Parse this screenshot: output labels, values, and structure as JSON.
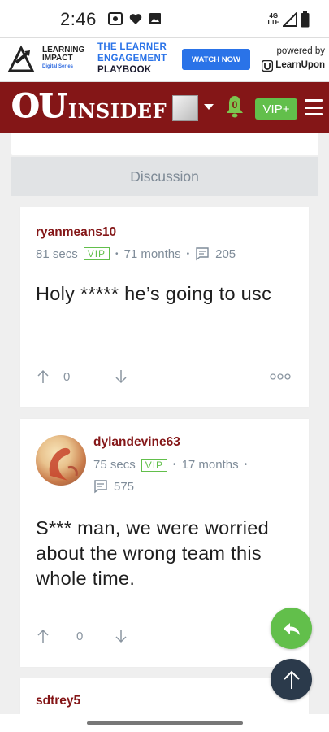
{
  "status_bar": {
    "time": "2:46",
    "network": "4G\nLTE",
    "icons": [
      "screen-record-icon",
      "heart-icon",
      "image-icon",
      "signal-icon",
      "battery-icon"
    ]
  },
  "ad": {
    "brand_line1": "LEARNING",
    "brand_line2": "IMPACT",
    "brand_sub": "Digital Series",
    "headline_1": "THE LEARNER",
    "headline_2": "ENGAGEMENT",
    "headline_3": "PLAYBOOK",
    "cta": "WATCH NOW",
    "powered_by": "powered by",
    "sponsor": "LearnUpon"
  },
  "header": {
    "brand_ou": "OU",
    "brand_insider": "INSIDEF",
    "notification_count": "0",
    "vip_label": "VIP+"
  },
  "section_title": "Discussion",
  "posts": [
    {
      "username": "ryanmeans10",
      "time": "81 secs",
      "badge": "VIP",
      "tenure": "71 months",
      "post_count": "205",
      "body": "Holy ***** he’s going to usc",
      "votes": "0"
    },
    {
      "username": "dylandevine63",
      "time": "75 secs",
      "badge": "VIP",
      "tenure": "17 months",
      "post_count": "575",
      "body": "S*** man, we were worried about the wrong team this whole time.",
      "votes": "0"
    },
    {
      "username": "sdtrey5"
    }
  ],
  "colors": {
    "crimson": "#841617",
    "accent_green": "#62bf4b",
    "fab_dark": "#2b3a4b",
    "meta_gray": "#7f8c99"
  }
}
